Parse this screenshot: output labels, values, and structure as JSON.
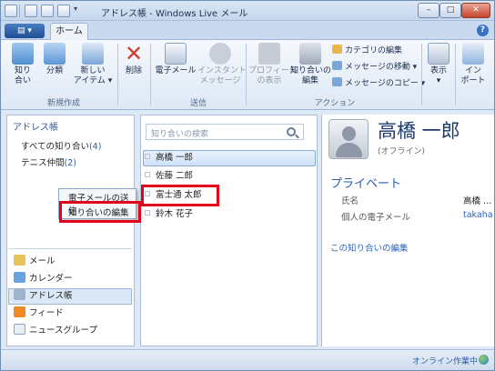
{
  "window": {
    "title": "アドレス帳 - Windows Live メール"
  },
  "ribbon": {
    "app_button": "▤ ▾",
    "tab_home": "ホーム",
    "groups": {
      "new": "新規作成",
      "send": "送信",
      "action": "アクション"
    },
    "buttons": {
      "contact": "知り\n合い",
      "category": "分類",
      "new_item": "新しい\nアイテム ▾",
      "delete": "削除",
      "email": "電子メール",
      "im": "インスタント\nメッセージ",
      "profile": "プロフィール\nの表示",
      "edit_contact": "知り合いの\n編集",
      "category_edit": "カテゴリの編集",
      "move_message": "メッセージの移動 ▾",
      "copy_message": "メッセージのコピー ▾",
      "view": "表示\n▾",
      "import": "イン\nポート"
    }
  },
  "left": {
    "header": "アドレス帳",
    "all_contacts": "すべての知り合い",
    "all_count": "(4)",
    "tennis": "テニス仲間",
    "tennis_count": "(2)",
    "context_menu": {
      "send_email": "電子メールの送信",
      "edit_contact": "知り合いの編集"
    },
    "nav": {
      "mail": "メール",
      "calendar": "カレンダー",
      "address_book": "アドレス帳",
      "feeds": "フィード",
      "newsgroups": "ニュースグループ"
    }
  },
  "middle": {
    "search_placeholder": "知り合いの検索",
    "contacts": [
      "高橋 一郎",
      "佐藤 二郎",
      "富士通 太郎",
      "鈴木 花子"
    ]
  },
  "detail": {
    "name": "高橋 一郎",
    "status": "(オフライン)",
    "section": "プライベート",
    "field_name": "氏名",
    "field_name_value": "高橋 …",
    "field_email": "個人の電子メール",
    "field_email_value": "takaha",
    "edit_link": "この知り合いの編集"
  },
  "statusbar": {
    "text": "オンライン作業中"
  },
  "colors": {
    "accent": "#2b5ea7",
    "highlight": "#e2001a"
  }
}
